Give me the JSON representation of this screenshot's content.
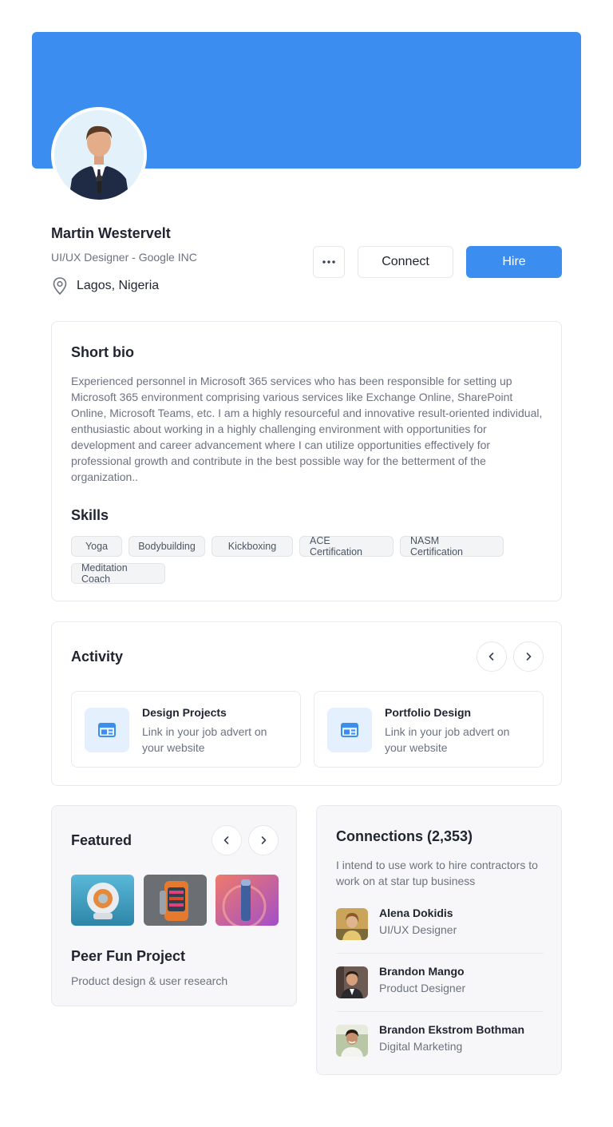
{
  "profile": {
    "name": "Martin Westervelt",
    "role": "UI/UX Designer - Google INC",
    "location": "Lagos, Nigeria",
    "more_icon": "ellipsis-icon",
    "location_icon": "map-pin-icon"
  },
  "actions": {
    "connect_label": "Connect",
    "hire_label": "Hire"
  },
  "bio": {
    "title": "Short bio",
    "text": "Experienced personnel in Microsoft 365 services who has been responsible for setting up Microsoft 365 environment comprising various services like Exchange Online, SharePoint Online, Microsoft Teams, etc. I am a highly resourceful and innovative result-oriented individual, enthusiastic about working in a highly challenging environment with opportunities for development and career advancement where I can utilize opportunities effectively for professional growth and contribute in the best possible way for the betterment of the organization.."
  },
  "skills": {
    "title": "Skills",
    "items": [
      "Yoga",
      "Bodybuilding",
      "Kickboxing",
      "ACE Certification",
      "NASM Certification",
      "Meditation Coach"
    ]
  },
  "activity": {
    "title": "Activity",
    "items": [
      {
        "title": "Design Projects",
        "desc": "Link in your job advert on your website",
        "icon": "browser-window-icon"
      },
      {
        "title": "Portfolio Design",
        "desc": "Link in your job advert on your website",
        "icon": "browser-window-icon"
      }
    ]
  },
  "featured": {
    "title": "Featured",
    "project_title": "Peer Fun Project",
    "project_sub": "Product design & user research"
  },
  "connections": {
    "title": "Connections (2,353)",
    "desc": "I intend to use work to hire contractors to work on at star tup business",
    "people": [
      {
        "name": "Alena Dokidis",
        "title": "UI/UX Designer"
      },
      {
        "name": "Brandon Mango",
        "title": "Product Designer"
      },
      {
        "name": "Brandon Ekstrom Bothman",
        "title": "Digital Marketing"
      }
    ]
  },
  "colors": {
    "accent": "#3b8ef0",
    "text": "#1f2430",
    "muted": "#6b7280"
  }
}
